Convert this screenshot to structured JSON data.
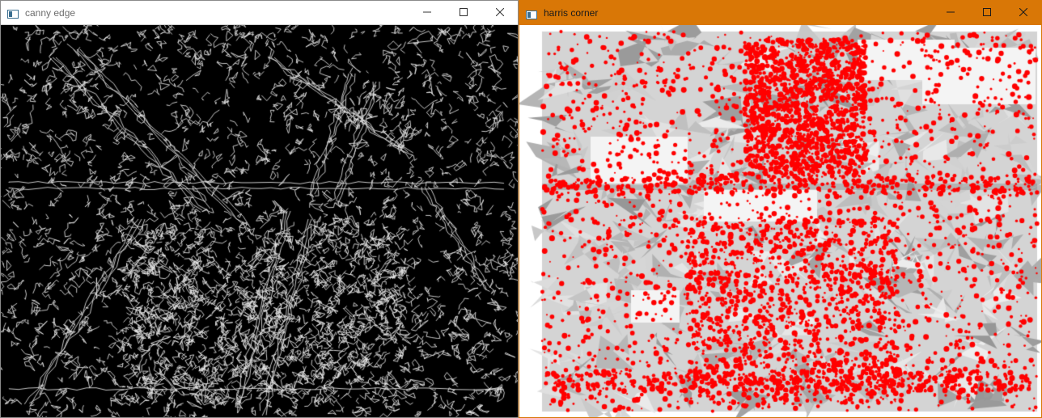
{
  "windows": {
    "canny": {
      "title": "canny edge",
      "frame_color": "#8a8a8a",
      "titlebar_color": "#ffffff",
      "icons": [
        "app-window-icon",
        "minimize-icon",
        "maximize-icon",
        "close-icon"
      ],
      "image_content": "edge map (white edges on black)"
    },
    "harris": {
      "title": "harris corner",
      "frame_color": "#d97706",
      "titlebar_color": "#d97706",
      "icons": [
        "app-window-icon",
        "minimize-icon",
        "maximize-icon",
        "close-icon"
      ],
      "marker_color": "#ff0000",
      "image_content": "grayscale image with red corner markers"
    }
  }
}
